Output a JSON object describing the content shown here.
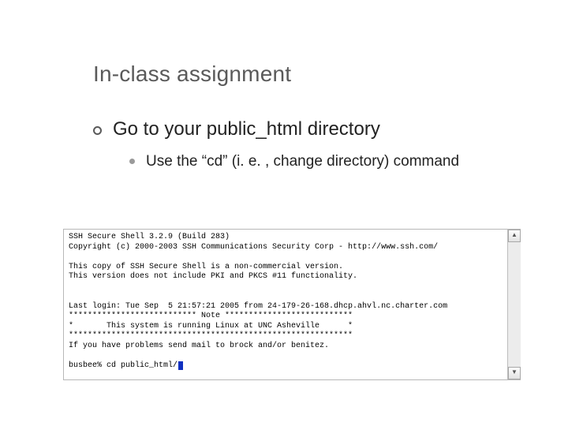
{
  "title": "In-class assignment",
  "bullet": "Go to your public_html directory",
  "subbullet": "Use the “cd” (i. e. , change directory) command",
  "terminal": {
    "lines": [
      "SSH Secure Shell 3.2.9 (Build 283)",
      "Copyright (c) 2000-2003 SSH Communications Security Corp - http://www.ssh.com/",
      "",
      "This copy of SSH Secure Shell is a non-commercial version.",
      "This version does not include PKI and PKCS #11 functionality.",
      "",
      "",
      "Last login: Tue Sep  5 21:57:21 2005 from 24-179-26-168.dhcp.ahvl.nc.charter.com",
      "*************************** Note ***************************",
      "*       This system is running Linux at UNC Asheville      *",
      "************************************************************",
      "If you have problems send mail to brock and/or benitez.",
      "",
      "busbee% cd public_html/"
    ],
    "scroll_up": "▲",
    "scroll_down": "▼"
  }
}
